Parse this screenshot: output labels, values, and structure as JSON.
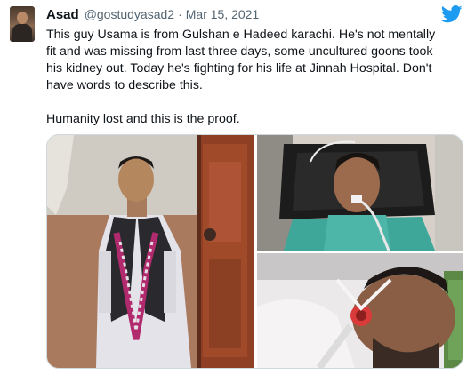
{
  "tweet": {
    "author_name": "Asad",
    "author_handle": "@gostudyasad2",
    "separator": "·",
    "date": "Mar 15, 2021",
    "text_lines": [
      "This guy Usama is from Gulshan e Hadeed karachi. He's not mentally",
      "fit and was missing from last three days, some uncultured goons took",
      "his kidney out. Today he's fighting for his life at Jinnah Hospital. Don't",
      "have words to describe this.",
      "",
      "Humanity lost and this is the proof."
    ]
  },
  "icons": {
    "platform": "twitter-bird-icon",
    "platform_color": "#1d9bf0"
  },
  "media": {
    "count": 3,
    "layout": "one-left-two-right-stacked"
  }
}
